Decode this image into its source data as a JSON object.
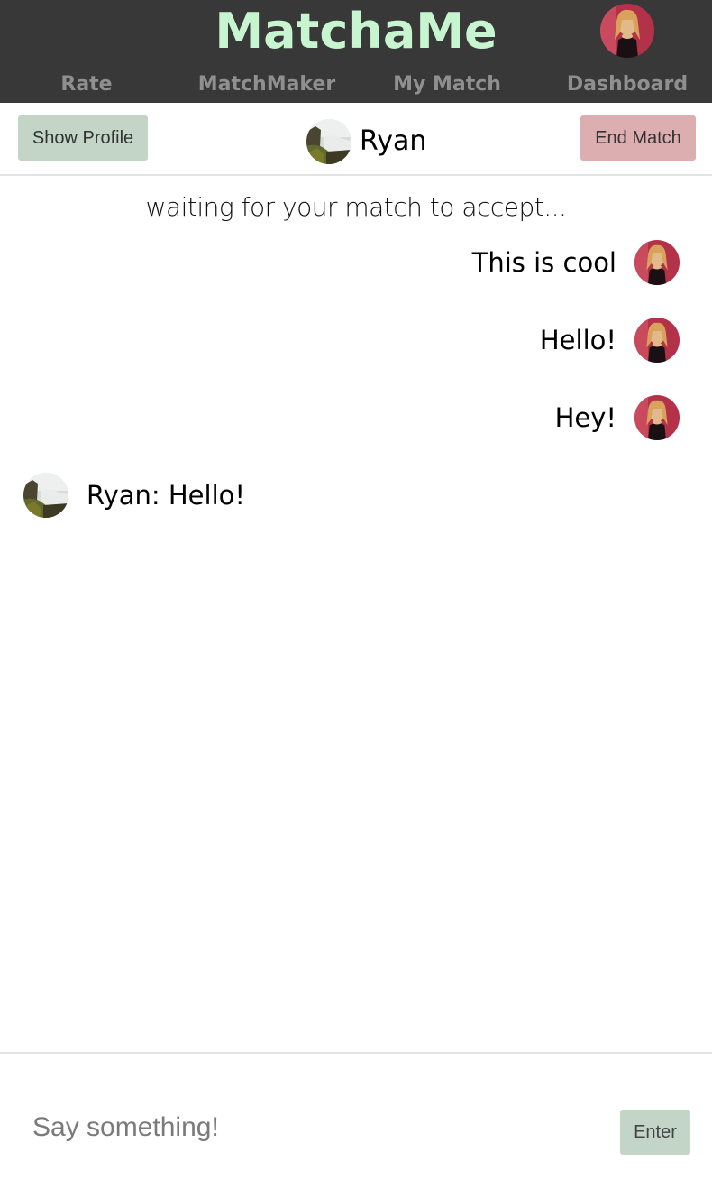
{
  "app": {
    "brand": "MatchaMe",
    "colors": {
      "topbar_bg": "#383838",
      "brand_color": "#c7f5cf",
      "nav_text": "#8f8f8f",
      "show_profile_bg": "#c2d5c6",
      "end_match_bg": "#dcaeb0",
      "enter_bg": "#c2d5c6"
    }
  },
  "nav": {
    "items": [
      {
        "label": "Rate"
      },
      {
        "label": "MatchMaker"
      },
      {
        "label": "My Match"
      },
      {
        "label": "Dashboard"
      }
    ],
    "user_avatar_icon": "user-avatar-icon"
  },
  "match_header": {
    "show_profile_label": "Show Profile",
    "end_match_label": "End Match",
    "match_name": "Ryan",
    "match_avatar_icon": "match-avatar-icon"
  },
  "chat": {
    "status": "waiting for your match to accept...",
    "messages": [
      {
        "sender": "me",
        "text": "This is cool"
      },
      {
        "sender": "me",
        "text": "Hello!"
      },
      {
        "sender": "me",
        "text": "Hey!"
      },
      {
        "sender": "match",
        "text": "Ryan: Hello!"
      }
    ]
  },
  "composer": {
    "placeholder": "Say something!",
    "value": "",
    "enter_label": "Enter"
  }
}
